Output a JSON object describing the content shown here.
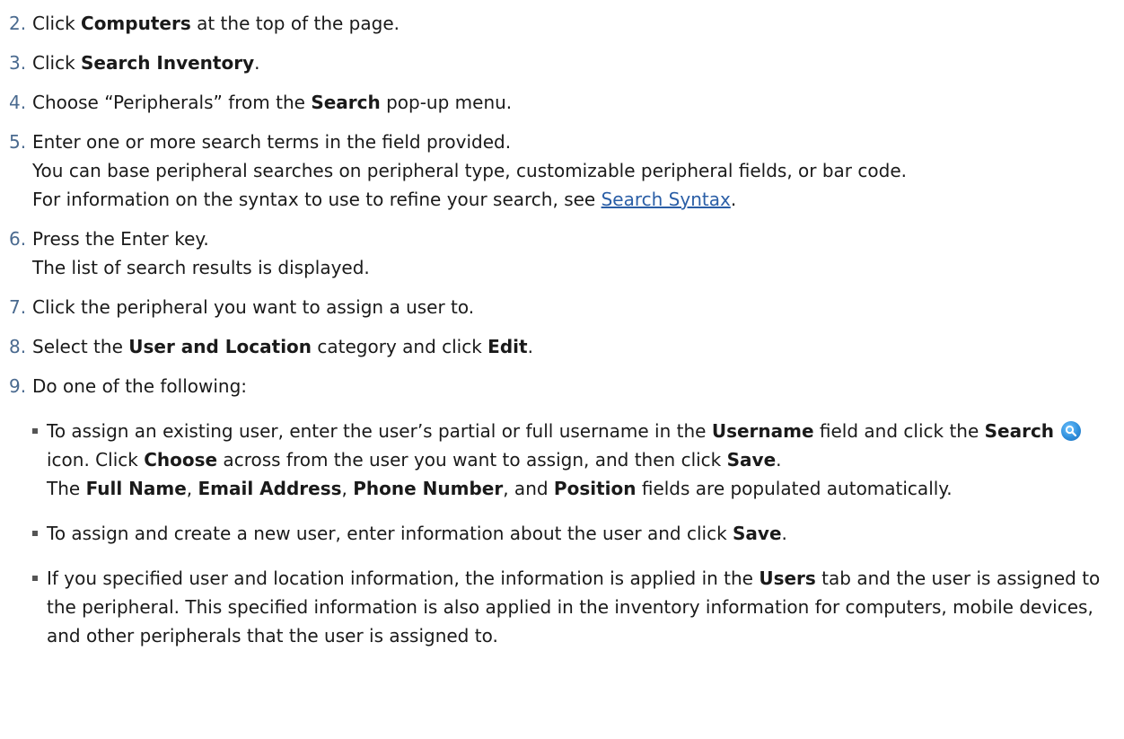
{
  "steps": [
    {
      "num": "2.",
      "pre": "Click ",
      "b1": "Computers",
      "post": " at the top of the page."
    },
    {
      "num": "3.",
      "pre": "Click ",
      "b1": "Search Inventory",
      "post": "."
    },
    {
      "num": "4.",
      "pre": "Choose “Peripherals” from the ",
      "b1": "Search",
      "post": " pop-up menu."
    },
    {
      "num": "5.",
      "line1": "Enter one or more search terms in the field provided.",
      "line2": "You can base peripheral searches on peripheral type, customizable peripheral fields, or bar code.",
      "line3_pre": "For information on the syntax to use to refine your search, see ",
      "line3_link": "Search Syntax",
      "line3_post": "."
    },
    {
      "num": "6.",
      "line1": "Press the Enter key.",
      "line2": "The list of search results is displayed."
    },
    {
      "num": "7.",
      "line1": "Click the peripheral you want to assign a user to."
    },
    {
      "num": "8.",
      "pre": "Select the ",
      "b1": "User and Location",
      "mid": " category and click ",
      "b2": "Edit",
      "post": "."
    },
    {
      "num": "9.",
      "line1": "Do one of the following:"
    }
  ],
  "bullets": {
    "b1": {
      "t1": "To assign an existing user, enter the user’s partial or full username in the ",
      "k1": "Username",
      "t2": " field and click the ",
      "k2": "Search",
      "t3": " icon. Click ",
      "k3": "Choose",
      "t4": " across from the user you want to assign, and then click ",
      "k4": "Save",
      "t5": ".",
      "t6": "The ",
      "k5": "Full Name",
      "t7": ", ",
      "k6": "Email Address",
      "t8": ", ",
      "k7": "Phone Number",
      "t9": ", and ",
      "k8": "Position",
      "t10": " fields are populated automatically."
    },
    "b2": {
      "t1": "To assign and create a new user, enter information about the user and click ",
      "k1": "Save",
      "t2": "."
    },
    "b3": {
      "t1": "If you specified user and location information, the information is applied in the ",
      "k1": "Users",
      "t2": " tab and the user is assigned to the peripheral. This specified information is also applied in the inventory information for computers, mobile devices, and other peripherals that the user is assigned to."
    }
  },
  "icons": {
    "search": "search-icon"
  },
  "colors": {
    "step_number": "#4a6a8f",
    "link": "#2a5ea6",
    "text": "#1a1a1a"
  }
}
